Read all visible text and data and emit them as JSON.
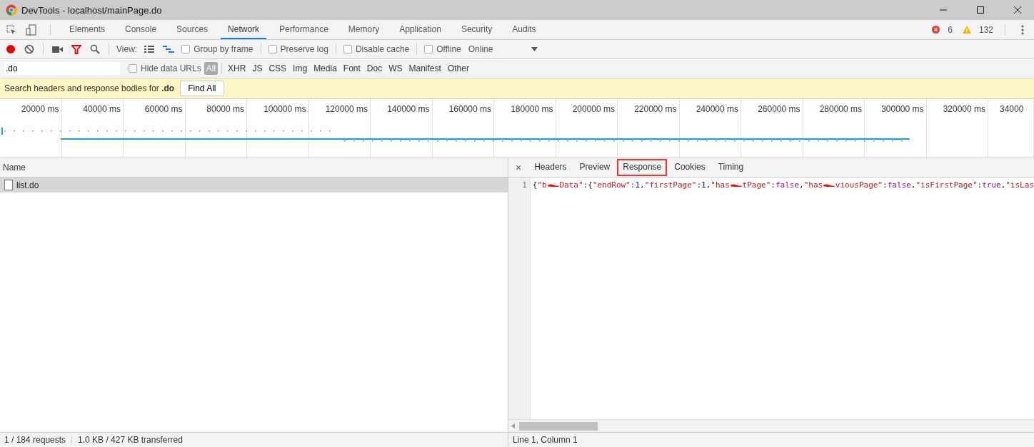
{
  "window": {
    "title": "DevTools - localhost/mainPage.do"
  },
  "panel_tabs": [
    {
      "label": "Elements",
      "selected": false
    },
    {
      "label": "Console",
      "selected": false
    },
    {
      "label": "Sources",
      "selected": false
    },
    {
      "label": "Network",
      "selected": true
    },
    {
      "label": "Performance",
      "selected": false
    },
    {
      "label": "Memory",
      "selected": false
    },
    {
      "label": "Application",
      "selected": false
    },
    {
      "label": "Security",
      "selected": false
    },
    {
      "label": "Audits",
      "selected": false
    }
  ],
  "counters": {
    "errors": "6",
    "warnings": "132"
  },
  "toolbar": {
    "recording": true,
    "filter_active": true,
    "view_label": "View:",
    "overview_shown": true,
    "checkboxes": [
      {
        "label": "Group by frame",
        "checked": false
      },
      {
        "label": "Preserve log",
        "checked": false
      },
      {
        "label": "Disable cache",
        "checked": false
      },
      {
        "label": "Offline",
        "checked": false
      }
    ],
    "throttling": "Online"
  },
  "filter_bar": {
    "value": ".do",
    "hide_data_urls": {
      "label": "Hide data URLs",
      "checked": false
    },
    "types": [
      {
        "label": "All",
        "selected": true
      },
      {
        "label": "XHR",
        "selected": false
      },
      {
        "label": "JS",
        "selected": false
      },
      {
        "label": "CSS",
        "selected": false
      },
      {
        "label": "Img",
        "selected": false
      },
      {
        "label": "Media",
        "selected": false
      },
      {
        "label": "Font",
        "selected": false
      },
      {
        "label": "Doc",
        "selected": false
      },
      {
        "label": "WS",
        "selected": false
      },
      {
        "label": "Manifest",
        "selected": false
      },
      {
        "label": "Other",
        "selected": false
      }
    ]
  },
  "search_banner": {
    "text": "Search headers and response bodies for **.do**",
    "button": "Find All"
  },
  "timeline": {
    "ticks": [
      "20000 ms",
      "40000 ms",
      "60000 ms",
      "80000 ms",
      "100000 ms",
      "120000 ms",
      "140000 ms",
      "160000 ms",
      "180000 ms",
      "200000 ms",
      "220000 ms",
      "240000 ms",
      "260000 ms",
      "280000 ms",
      "300000 ms",
      "320000 ms",
      "34000"
    ]
  },
  "requests": {
    "column": "Name",
    "rows": [
      {
        "name": "list.do",
        "selected": true
      }
    ]
  },
  "detail": {
    "close": "×",
    "tabs": [
      {
        "label": "Headers",
        "selected": false
      },
      {
        "label": "Preview",
        "selected": false
      },
      {
        "label": "Response",
        "selected": true
      },
      {
        "label": "Cookies",
        "selected": false
      },
      {
        "label": "Timing",
        "selected": false
      }
    ],
    "line_number": "1",
    "tokens": [
      {
        "kind": "punct",
        "text": "{"
      },
      {
        "kind": "string",
        "text": "\"b"
      },
      {
        "kind": "redaction"
      },
      {
        "kind": "string",
        "text": "Data\""
      },
      {
        "kind": "punct",
        "text": ":{"
      },
      {
        "kind": "string",
        "text": "\"endRow\""
      },
      {
        "kind": "punct",
        "text": ":"
      },
      {
        "kind": "number",
        "text": "1"
      },
      {
        "kind": "punct",
        "text": ","
      },
      {
        "kind": "string",
        "text": "\"firstPage\""
      },
      {
        "kind": "punct",
        "text": ":"
      },
      {
        "kind": "number",
        "text": "1"
      },
      {
        "kind": "punct",
        "text": ","
      },
      {
        "kind": "string",
        "text": "\"has"
      },
      {
        "kind": "redaction"
      },
      {
        "kind": "string",
        "text": "tPage\""
      },
      {
        "kind": "punct",
        "text": ":"
      },
      {
        "kind": "keyword",
        "text": "false"
      },
      {
        "kind": "punct",
        "text": ","
      },
      {
        "kind": "string",
        "text": "\"has"
      },
      {
        "kind": "redaction"
      },
      {
        "kind": "string",
        "text": "viousPage\""
      },
      {
        "kind": "punct",
        "text": ":"
      },
      {
        "kind": "keyword",
        "text": "false"
      },
      {
        "kind": "punct",
        "text": ","
      },
      {
        "kind": "string",
        "text": "\"isFirstPage\""
      },
      {
        "kind": "punct",
        "text": ":"
      },
      {
        "kind": "keyword",
        "text": "true"
      },
      {
        "kind": "punct",
        "text": ","
      },
      {
        "kind": "string",
        "text": "\"isLas"
      }
    ]
  },
  "status_bar": {
    "requests": "1 / 184 requests",
    "transferred": "1.0 KB / 427 KB transferred",
    "position": "Line 1, Column 1"
  }
}
